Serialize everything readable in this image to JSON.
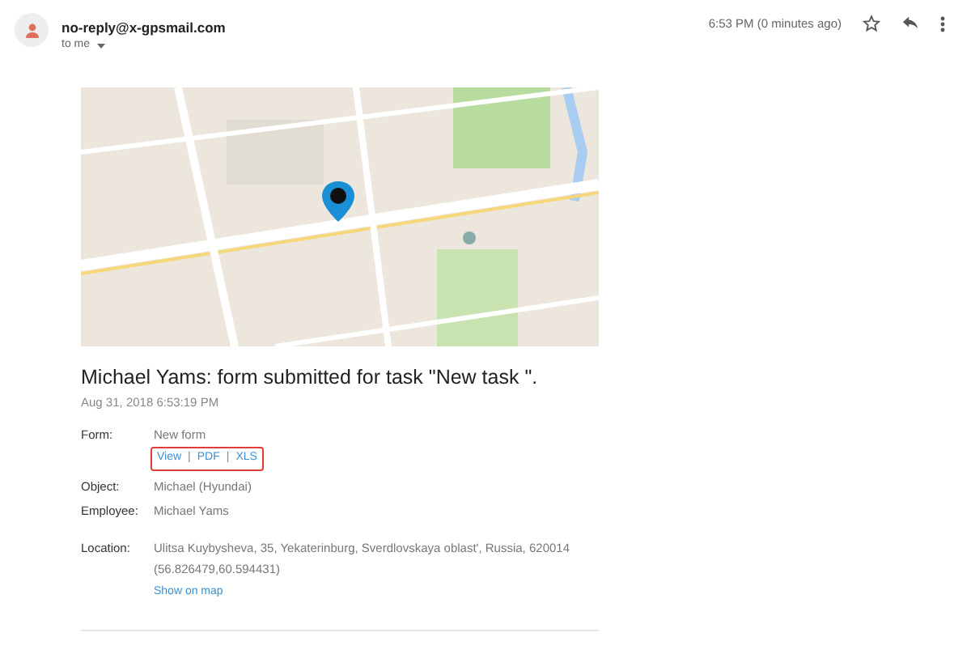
{
  "sender": "no-reply@x-gpsmail.com",
  "recipient": "to me",
  "time": "6:53 PM (0 minutes ago)",
  "title": "Michael Yams: form submitted for task \"New task \".",
  "date": "Aug 31, 2018 6:53:19 PM",
  "fields": [
    {
      "label": "Form:",
      "value": "New form",
      "links": [
        "View",
        "PDF",
        "XLS"
      ],
      "link_separator": "|"
    },
    {
      "label": "Object:",
      "value": "Michael (Hyundai)"
    },
    {
      "label": "Employee:",
      "value": "Michael Yams"
    },
    {
      "label": "Location:",
      "value": "Ulitsa Kuybysheva, 35, Yekaterinburg, Sverdlovskaya oblast', Russia, 620014",
      "extra": "(56.826479,60.594431)",
      "link": "Show on map"
    }
  ]
}
